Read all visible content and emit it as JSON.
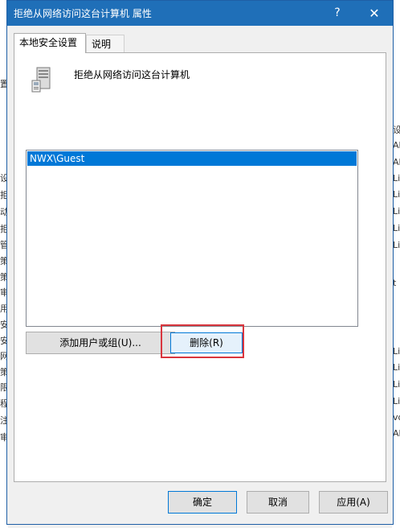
{
  "window": {
    "title": "拒绝从网络访问这台计算机 属性",
    "help_glyph": "?",
    "close_glyph": "✕"
  },
  "tabs": [
    {
      "label": "本地安全设置",
      "active": true
    },
    {
      "label": "说明",
      "active": false
    }
  ],
  "policy": {
    "name": "拒绝从网络访问这台计算机",
    "icon": "server-icon"
  },
  "list": {
    "items": [
      "NWX\\Guest"
    ],
    "selected_index": 0
  },
  "buttons": {
    "add": "添加用户或组(U)...",
    "remove": "删除(R)",
    "ok": "确定",
    "cancel": "取消",
    "apply": "应用(A)"
  },
  "background_fragments": {
    "left": [
      "置",
      "设",
      "拒",
      "动",
      "拒",
      "管",
      "策",
      "策",
      "审",
      "用",
      "安",
      "安",
      "网",
      "策",
      "限",
      "程",
      "注",
      "审"
    ],
    "right": [
      "设",
      "Al",
      "Al",
      "Lin",
      "Lin",
      "Lin",
      "Lin",
      "Lin",
      "t",
      "Lin",
      "Lin",
      "Lin",
      "Lin",
      "vo",
      "Al"
    ]
  },
  "colors": {
    "titlebar": "#1f6fb8",
    "selection": "#0078d7",
    "highlight_box": "#d9363e"
  }
}
